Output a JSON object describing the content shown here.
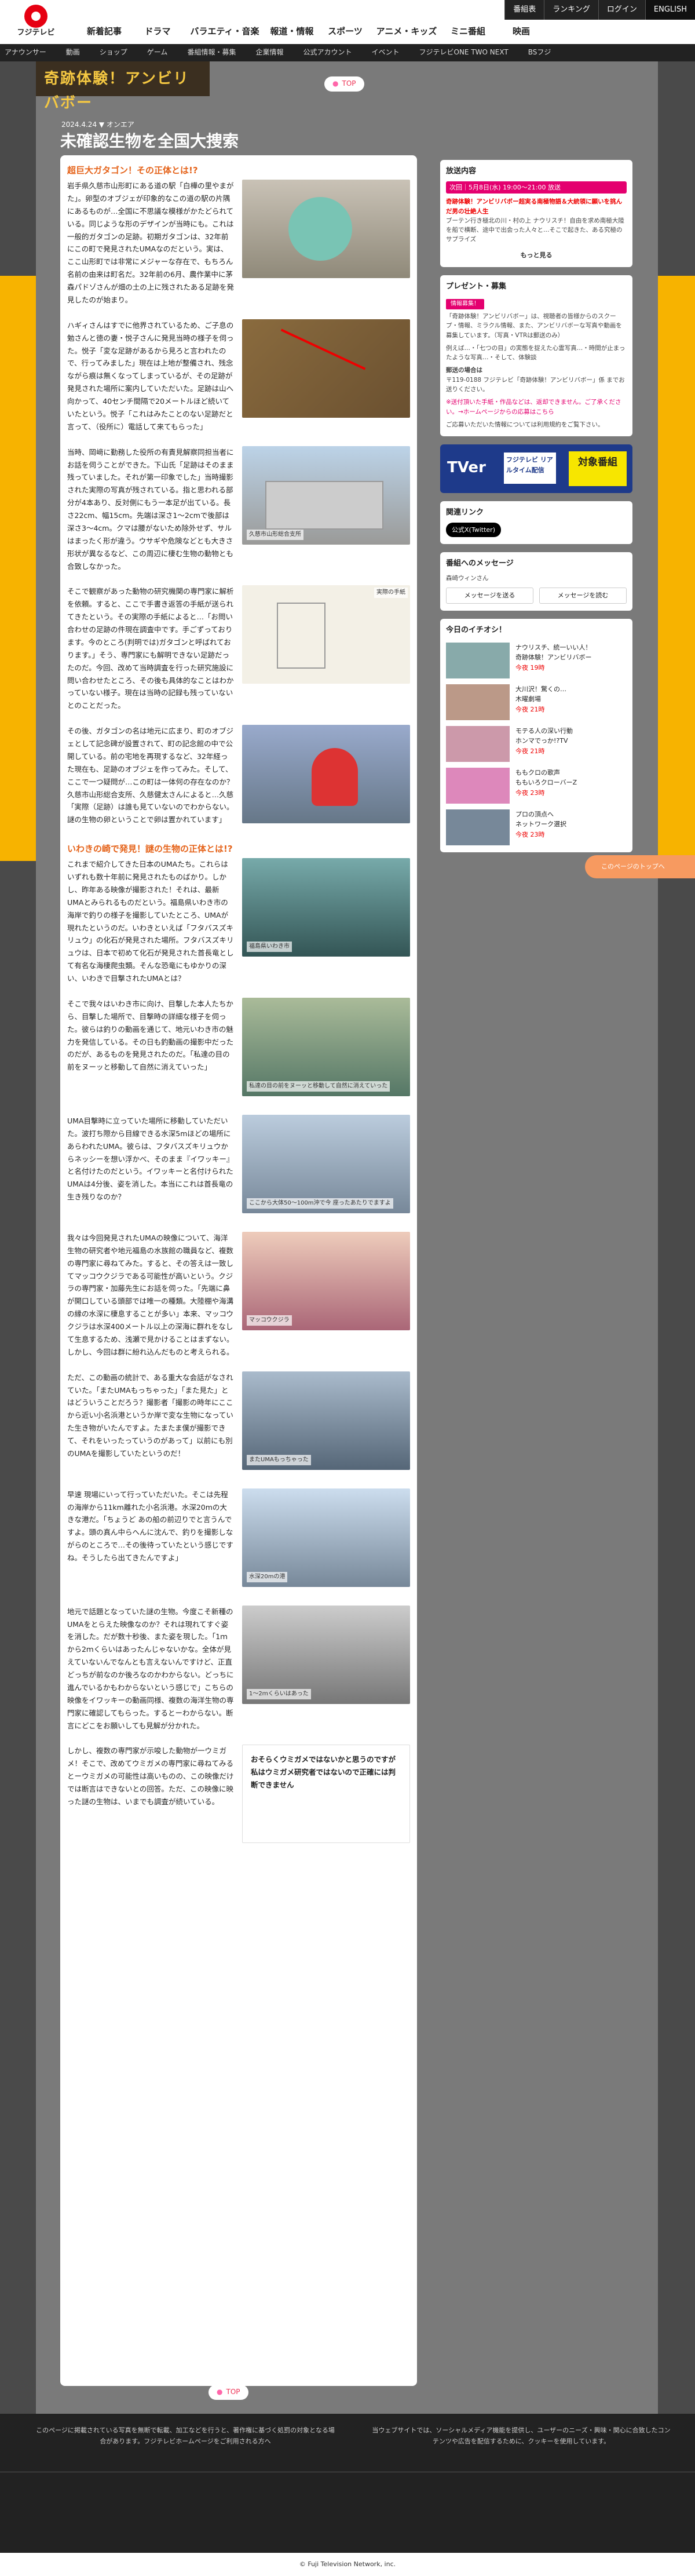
{
  "global": {
    "logo_text": "フジテレビ",
    "util": [
      "番組表",
      "ランキング",
      "ログイン",
      "ENGLISH"
    ],
    "main_nav": [
      "新着記事",
      "ドラマ",
      "バラエティ・音楽",
      "報道・情報",
      "スポーツ",
      "アニメ・キッズ",
      "ミニ番組",
      "映画"
    ],
    "sub_nav": [
      "アナウンサー",
      "動画",
      "ショップ",
      "ゲーム",
      "番組情報・募集",
      "企業情報",
      "公式アカウント",
      "イベント",
      "フジテレビONE TWO NEXT",
      "BSフジ"
    ]
  },
  "site_banner": "奇跡体験！アンビリバボー",
  "top_label": "TOP",
  "article": {
    "date": "2024.4.24 ▼ オンエア",
    "title": "未確認生物を全国大捜索",
    "sections": [
      {
        "heading": "超巨大ガタゴン！その正体とは!?",
        "text": "岩手県久慈市山形町にある道の駅「白樺の里やまがた」。卵型のオブジェが印象的なこの道の駅の片隅にあるものが…全国に不思議な模様がかたどられている。同じような形のデザインが当時にも。これは一般的ガタゴンの足跡。初期ガタゴンは、32年前にこの町で発見されたUMAなのだという。実は、ここ山形町では非常にメジャーな存在で、もちろん名前の由来は町名だ。32年前の6月、農作業中に茅森パドゾさんが畑の土の上に残されたある足跡を発見したのが始まり。"
      },
      {
        "heading": "",
        "text": "ハギィさんはすでに他界されているため、ご子息の勉さんと徳の妻・悦子さんに発見当時の様子を伺った。悦子「変な足跡があるから見ろと言われたので、行ってみました」現在は上地が整備され、残念ながら痕は無くなってしまっているが、その足跡が発見された場所に案内していただいた。足跡は山へ向かって、40センチ間隔で20メートルほど続いていたという。悦子「これはみたことのない足跡だと言って、（役所に）電話して来てもらった」"
      },
      {
        "heading": "",
        "text": "当時、岡﨑に勤務した役所の有責見解察同担当者にお話を伺うことができた。下山氏「足跡はそのまま残っていました。それが第一印象でした」当時撮影された実際の写真が残されている。指と思われる部分が4本あり、反対側にもう一本足が出ている。長さ22cm、幅15cm。先端は深さ1〜2cmで後部は深さ3〜4cm。クマは腰がないため除外せず、サルはまったく形が違う。ウサギや危険などとも大きさ形状が異なるなど、この周辺に棲む生物の動物とも合致しなかった。"
      },
      {
        "heading": "",
        "text": "そこで観察があった動物の研究機関の専門家に解析を依頼。すると、ここで手書き返答の手紙が送られてきたという。その実際の手紙によると…「お問い合わせの足跡の件現在調査中です。手ごずっております。今のところ(判明では)ガタゴンと呼ばれております。」そう、専門家にも解明できない足跡だったのだ。今回、改めて当時調査を行った研究施設に問い合わせたところ、その後も具体的なことはわかっていない様子。現在は当時の記録も残っていないとのことだった。"
      },
      {
        "heading": "",
        "text": "その後、ガタゴンの名は地元に広まり、町のオブジェとして記念碑が設置されて、町の記念館の中で公開している。前の宅地を再現するなど、32年経った現在も、足跡のオブジェを作ってみた。そして、ここで一つ疑問が…この町は一体何の存在なのか？久慈市山形総合支所、久慈健太さんによると…久慈「実際（足跡）は誰も見ていないのでわからない。謎の生物の卵ということで卵は置かれています」"
      },
      {
        "heading": "いわきの崎で発見！謎の生物の正体とは!?",
        "text": "これまで紹介してきた日本のUMAたち。これらはいずれも数十年前に発見されたものばかり。しかし、昨年ある映像が撮影された！それは、最新UMAとみられるものだという。福島県いわき市の海岸で釣りの様子を撮影していたところ、UMAが現れたというのだ。いわきといえば「フタバスズキリュウ」の化石が発見された場所。フタバスズキリュウは、日本で初めて化石が発見された首長竜として有名な海棲爬虫類。そんな恐竜にもゆかりの深い、いわきで目撃されたUMAとは？"
      },
      {
        "heading": "",
        "text": "そこで我々はいわき市に向け、目撃した本人たちから、目撃した場所で、目撃時の詳細な様子を伺った。彼らは釣りの動画を通じて、地元いわき市の魅力を発信している。その日も釣動画の撮影中だったのだが、あるものを発見されたのだ。「私達の目の前をヌーッと移動して自然に消えていった」"
      },
      {
        "heading": "",
        "text": "UMA目撃時に立っていた場所に移動していただいた。波打ち際から目線できる水深5mほどの場所にあらわれたUMA。彼らは、フタバスズキリュウからネッシーを想い浮かべ、そのまま『イワッキー』と名付けたのだという。イワッキーと名付けられたUMAは4分後、姿を消した。本当にこれは首長竜の生き残りなのか？"
      },
      {
        "heading": "",
        "text": "我々は今回発見されたUMAの映像について、海洋生物の研究者や地元福島の水族館の職員など、複数の専門家に尋ねてみた。すると、その答えは一致してマッコウクジラである可能性が高いという。クジラの専門家・加藤先生にお話を伺った。「先端に鼻が開口している頭部では唯一の種類。大陸棚や海溝の縁の水深に棲息することが多い」本来、マッコウクジラは水深400メートル以上の深海に群れをなして生息するため、浅瀬で見かけることはまずない。しかし、今回は群に紛れ込んだものと考えられる。"
      },
      {
        "heading": "",
        "text": "ただ、この動画の統計で、ある重大な会話がなされていた。「またUMAもっちゃった」「また見た」とはどういうことだろう？撮影者「撮影の時年にここから近い小名浜港というか岸で変な生物になっていた生き物がいたんですよ。たまたま僕が撮影できて、それをいったっていうのがあって」以前にも別のUMAを撮影していたというのだ！"
      },
      {
        "heading": "",
        "text": "早速 現場にいって行っていただいた。そこは先程の海岸から11km離れた小名浜港。水深20mの大きな港だ。「ちょうど あの船の前辺りでと言うんですよ。頭の真ん中らへんに沈んで、釣りを撮影しながらのところで…その後待っていたという感じですね。そうしたら出てきたんですよ」"
      },
      {
        "heading": "",
        "text": "地元で話題となっていた謎の生物。今度こそ新種のUMAをとらえた映像なのか？それは現れてすぐ姿を消した。だが数十秒後、また姿を現した。「1ｍから2ｍくらいはあったんじゃないかな。全体が見えていないんでなんとも言えないんですけど、正直どっちが前なのか後ろなのかわからない。どっちに進んでいるかもわからないという感じで」こちらの映像をイワッキーの動画同様、複数の海洋生物の専門家に確認してもらった。するとーわからない。断言にどこをお願いしても見解が分かれた。"
      },
      {
        "heading": "",
        "text": "しかし、複数の専門家が示唆した動物が一ウミガメ！そこで、改めてウミガメの専門家に尋ねてみるとーウミガメの可能性は高いものの、この映像だけでは断言はできないとの回答。ただ、この映像に映った謎の生物は、いまでも調査が続いている。"
      }
    ],
    "captions": [
      "久慈市山形総合支所",
      "福島県いわき市",
      "私達の目の前をヌーッと移動して自然に消えていった",
      "ここから大体50〜100m沖で今 座ったあたりでますよ",
      "マッコウクジラ",
      "またUMAもっちゃった",
      "水深20mの港",
      "1〜2ｍくらいはあった"
    ],
    "page4_note": "実際の手紙",
    "bottom_note": "おそらくウミガメではないかと思うのですが 私はウミガメ研究者ではないので正確には判断できません"
  },
  "sidebar": {
    "next": {
      "label": "放送内容",
      "badge": "次回｜5月8日(水) 19:00〜21:00 放送",
      "title": "奇跡体験！アンビリバボー超実る南極物語＆大統領に願いを挑んだ男の壮絶人生",
      "desc": "ブーテン行き極北の川・村の上 ナウリスチ！自由を求め南極大陸を船で横断、途中で出会った人々と…そこで起きた、ある究極のサプライズ",
      "more": "もっと見る"
    },
    "present": {
      "label": "プレゼント・募集",
      "badge": "情報募集！",
      "body1": "「奇跡体験！アンビリバボー」は、視聴者の皆様からのスクープ・情報、ミラクル情報、また、アンビリバボーな写真や動画を募集しています。（写真・VTRは郵送のみ）",
      "body2": "例えば…・「七つの目」の実態を捉えた心霊写真…・時間が止まったような写真…・そして、体験談",
      "addr_label": "郵送の場合は",
      "addr": "〒119-0188 フジテレビ「奇跡体験！アンビリバボー」係 までお送りください。",
      "notes": "※送付頂いた手紙・作品などは、返却できません。ご了承ください。→ホームページからの応募はこちら",
      "privacy": "ご応募いただいた情報については利用規約をご覧下さい。"
    },
    "tver": {
      "left": "TVer",
      "mid": "フジテレビ リアルタイム配信",
      "right": "対象番組"
    },
    "related": {
      "label": "関連リンク",
      "x": "公式X(Twitter)"
    },
    "message": {
      "label": "番組へのメッセージ",
      "anchor": "森崎ウィンさん",
      "btn1": "メッセージを送る",
      "btn2": "メッセージを読む"
    },
    "today": {
      "label": "今日のイチオシ！",
      "items": [
        {
          "title": "ナウリスチ、統一いい人！",
          "show": "奇跡体験！アンビリバボー",
          "time": "今夜 19時"
        },
        {
          "title": "大川沢！驚くの…",
          "show": "木曜劇場",
          "time": "今夜 21時"
        },
        {
          "title": "モテる人の深い行動",
          "show": "ホンマでっか!?TV",
          "time": "今夜 21時"
        },
        {
          "title": "ももクロの歌声",
          "show": "ももいろクローバーZ",
          "time": "今夜 23時"
        },
        {
          "title": "プロの頂点へ",
          "show": "ネットワーク選択",
          "time": "今夜 23時"
        }
      ]
    },
    "follow_btn": "このページのトップへ"
  },
  "footer": {
    "left": "このページに掲載されている写真を無断で転載、加工などを行うと、著作権に基づく処罰の対象となる場合があります。フジテレビホームページをご利用される方へ",
    "right": "当ウェブサイトでは、ソーシャルメディア機能を提供し、ユーザーのニーズ・興味・関心に合致したコンテンツや広告を配信するために、クッキーを使用しています。",
    "copyright": "© Fuji Television Network, inc."
  }
}
